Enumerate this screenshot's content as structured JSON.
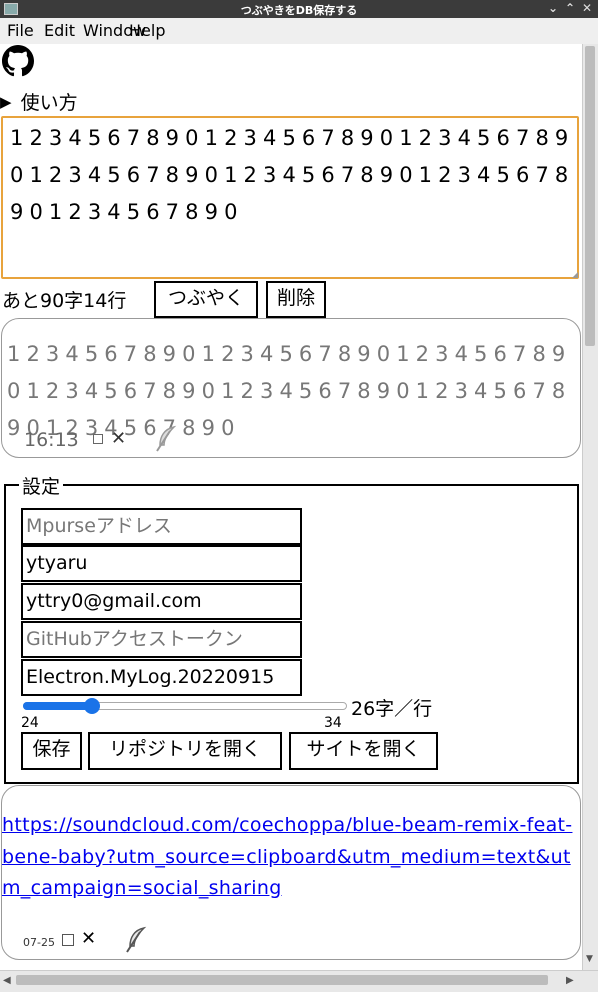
{
  "window": {
    "title": "つぶやきをDB保存する",
    "controls": [
      "⌄",
      "⌃",
      "✕"
    ]
  },
  "menu": [
    "File",
    "Edit",
    "Window",
    "Help"
  ],
  "app": {
    "howto_label": "使い方",
    "editor_text": "1234567890123456789012345678901234567890123456789012345678901234567890",
    "remaining": "あと90字14行",
    "tweet_button": "つぶやく",
    "delete_button": "削除",
    "post1": {
      "text": "1234567890123456789012345678901234567890123456789012345678901234567890",
      "time": "16:13",
      "delete_mark": "✕"
    },
    "settings": {
      "legend": "設定",
      "mpurse_placeholder": "Mpurseアドレス",
      "username": "ytyaru",
      "email": "yttry0@gmail.com",
      "token_placeholder": "GitHubアクセストークン",
      "repo": "Electron.MyLog.20220915",
      "slider_label": "26字／行",
      "slider_min": "24",
      "slider_max": "34",
      "slider_value": 26,
      "save_button": "保存",
      "open_repo_button": "リポジトリを開く",
      "open_site_button": "サイトを開く"
    },
    "post2": {
      "link": "https://soundcloud.com/coechoppa/blue-beam-remix-feat-bene-baby?utm_source=clipboard&utm_medium=text&utm_campaign=social_sharing",
      "date": "07-25",
      "delete_mark": "✕"
    }
  }
}
